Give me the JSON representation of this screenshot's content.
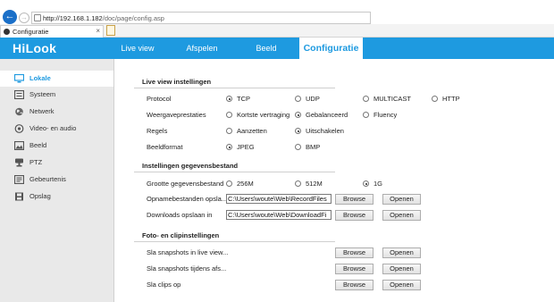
{
  "browser": {
    "url_host": "http://192.168.1.182",
    "url_path": "/doc/page/config.asp",
    "tab_title": "Configuratie",
    "tab_close": "×"
  },
  "header": {
    "logo": "HiLook",
    "nav": [
      "Live view",
      "Afspelen",
      "Beeld",
      "Configuratie"
    ],
    "active_nav": "Configuratie",
    "accent_color": "#1e9ae0"
  },
  "sidebar": {
    "items": [
      {
        "label": "Lokale",
        "icon": "monitor-icon",
        "active": true
      },
      {
        "label": "Systeem",
        "icon": "system-icon",
        "active": false
      },
      {
        "label": "Netwerk",
        "icon": "globe-icon",
        "active": false
      },
      {
        "label": "Video- en audio",
        "icon": "video-icon",
        "active": false
      },
      {
        "label": "Beeld",
        "icon": "image-icon",
        "active": false
      },
      {
        "label": "PTZ",
        "icon": "ptz-icon",
        "active": false
      },
      {
        "label": "Gebeurtenis",
        "icon": "event-icon",
        "active": false
      },
      {
        "label": "Opslag",
        "icon": "storage-icon",
        "active": false
      }
    ]
  },
  "live_view": {
    "title": "Live view instellingen",
    "protocol": {
      "label": "Protocol",
      "options": [
        "TCP",
        "UDP",
        "MULTICAST",
        "HTTP"
      ],
      "selected": "TCP"
    },
    "performance": {
      "label": "Weergaveprestaties",
      "options": [
        "Kortste vertraging",
        "Gebalanceerd",
        "Fluency"
      ],
      "selected": "Gebalanceerd"
    },
    "rules": {
      "label": "Regels",
      "options": [
        "Aanzetten",
        "Uitschakelen"
      ],
      "selected": "Uitschakelen"
    },
    "format": {
      "label": "Beeldformat",
      "options": [
        "JPEG",
        "BMP"
      ],
      "selected": "JPEG"
    }
  },
  "record": {
    "title": "Instellingen gegevensbestand",
    "size": {
      "label": "Grootte gegevensbestand",
      "options": [
        "256M",
        "512M",
        "1G"
      ],
      "selected": "1G"
    },
    "save_path": {
      "label": "Opnamebestanden opsla...",
      "value": "C:\\Users\\woute\\Web\\RecordFiles"
    },
    "download_path": {
      "label": "Downloads opslaan in",
      "value": "C:\\Users\\woute\\Web\\DownloadFi"
    }
  },
  "snapshot": {
    "title": "Foto- en clipinstellingen",
    "rows": [
      "Sla snapshots in live view...",
      "Sla snapshots tijdens afs...",
      "Sla clips op"
    ]
  },
  "buttons": {
    "browse": "Browse",
    "open": "Openen"
  }
}
